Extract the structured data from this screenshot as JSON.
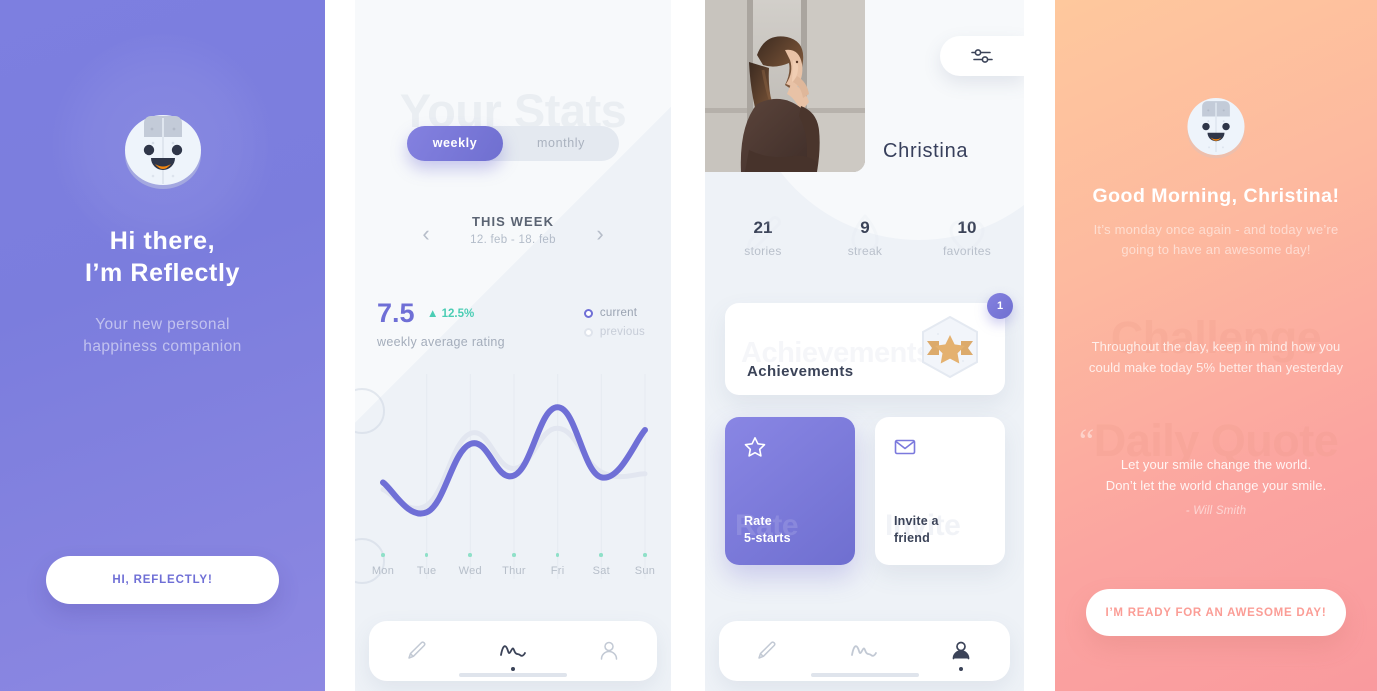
{
  "meta": {
    "app_name": "Reflectly",
    "screens": 4
  },
  "colors": {
    "purple": "#6f6fd6",
    "purple_light": "#8481e0",
    "bg_light": "#eef2f7",
    "teal": "#4bcdb4",
    "navy": "#3b4358",
    "muted": "#b6bec9",
    "peach_start": "#fec89d",
    "peach_end": "#f99a9e",
    "gold": "#dfae6e"
  },
  "onboarding": {
    "title_line1": "Hi there,",
    "title_line2": "I’m Reflectly",
    "subtitle_line1": "Your new personal",
    "subtitle_line2": "happiness companion",
    "cta_label": "HI, REFLECTLY!",
    "mascot_icon": "reflectly-mascot-icon"
  },
  "stats": {
    "ghost_heading": "Your Stats",
    "segments": [
      {
        "label": "weekly",
        "active": true
      },
      {
        "label": "monthly",
        "active": false
      }
    ],
    "prev_arrow_icon": "chevron-left-icon",
    "next_arrow_icon": "chevron-right-icon",
    "period_title": "THIS WEEK",
    "period_range": "12. feb - 18. feb",
    "score_value": "7.5",
    "score_delta": "▲ 12.5%",
    "score_caption": "weekly average rating",
    "legend": [
      {
        "label": "current",
        "active": true
      },
      {
        "label": "previous",
        "active": false
      }
    ],
    "nav": [
      {
        "icon": "pencil-icon",
        "active": false
      },
      {
        "icon": "wave-chart-icon",
        "active": true
      },
      {
        "icon": "person-icon",
        "active": false
      }
    ],
    "chart_data": {
      "type": "line",
      "title": "weekly average rating",
      "xlabel": "",
      "ylabel": "rating",
      "categories": [
        "Mon",
        "Tue",
        "Wed",
        "Thur",
        "Fri",
        "Sat",
        "Sun"
      ],
      "ylim": [
        0,
        10
      ],
      "grid": true,
      "legend_position": "top-right",
      "series": [
        {
          "name": "current",
          "color": "#6f6fd6",
          "values": [
            4.6,
            2.9,
            6.8,
            5.0,
            8.9,
            4.9,
            7.6
          ]
        },
        {
          "name": "previous",
          "color": "#e2e6f0",
          "values": [
            4.2,
            3.3,
            7.4,
            5.4,
            7.7,
            5.2,
            5.1
          ]
        }
      ]
    }
  },
  "profile": {
    "name": "Christina",
    "settings_icon": "sliders-icon",
    "photo_alt": "portrait-photo",
    "stats": [
      {
        "value": "21",
        "label": "stories",
        "watermark_icon": "pencil-icon"
      },
      {
        "value": "9",
        "label": "streak",
        "watermark_icon": "flame-icon"
      },
      {
        "value": "10",
        "label": "favorites",
        "watermark_icon": "heart-icon"
      }
    ],
    "achievements": {
      "title": "Achievements",
      "ghost_text": "Achievements",
      "badge_count": "1",
      "medal_icon": "star-medal-icon"
    },
    "tiles": [
      {
        "icon": "star-outline-icon",
        "ghost_text": "Rate",
        "label_line1": "Rate",
        "label_line2": "5-starts",
        "style": "purple"
      },
      {
        "icon": "envelope-icon",
        "ghost_text": "Invite",
        "label_line1": "Invite a",
        "label_line2": "friend",
        "style": "white"
      }
    ],
    "nav": [
      {
        "icon": "pencil-icon",
        "active": false
      },
      {
        "icon": "wave-chart-icon",
        "active": false
      },
      {
        "icon": "person-icon",
        "active": true
      }
    ]
  },
  "morning": {
    "mascot_icon": "reflectly-mascot-icon",
    "greeting": "Good Morning, Christina!",
    "sub_line1": "It’s monday once again - and today we’re",
    "sub_line2": "going to have an awesome day!",
    "challenge_ghost": "Challenge",
    "challenge_line1": "Throughout the day, keep in mind how you",
    "challenge_line2": "could make today 5% better than yesterday",
    "quote_ghost": "Daily Quote",
    "quote_mark": "“",
    "quote_line1": "Let your smile change the world.",
    "quote_line2": "Don’t let the world change your smile.",
    "quote_author": "- Will Smith",
    "cta_label": "I’M READY FOR AN AWESOME DAY!"
  }
}
